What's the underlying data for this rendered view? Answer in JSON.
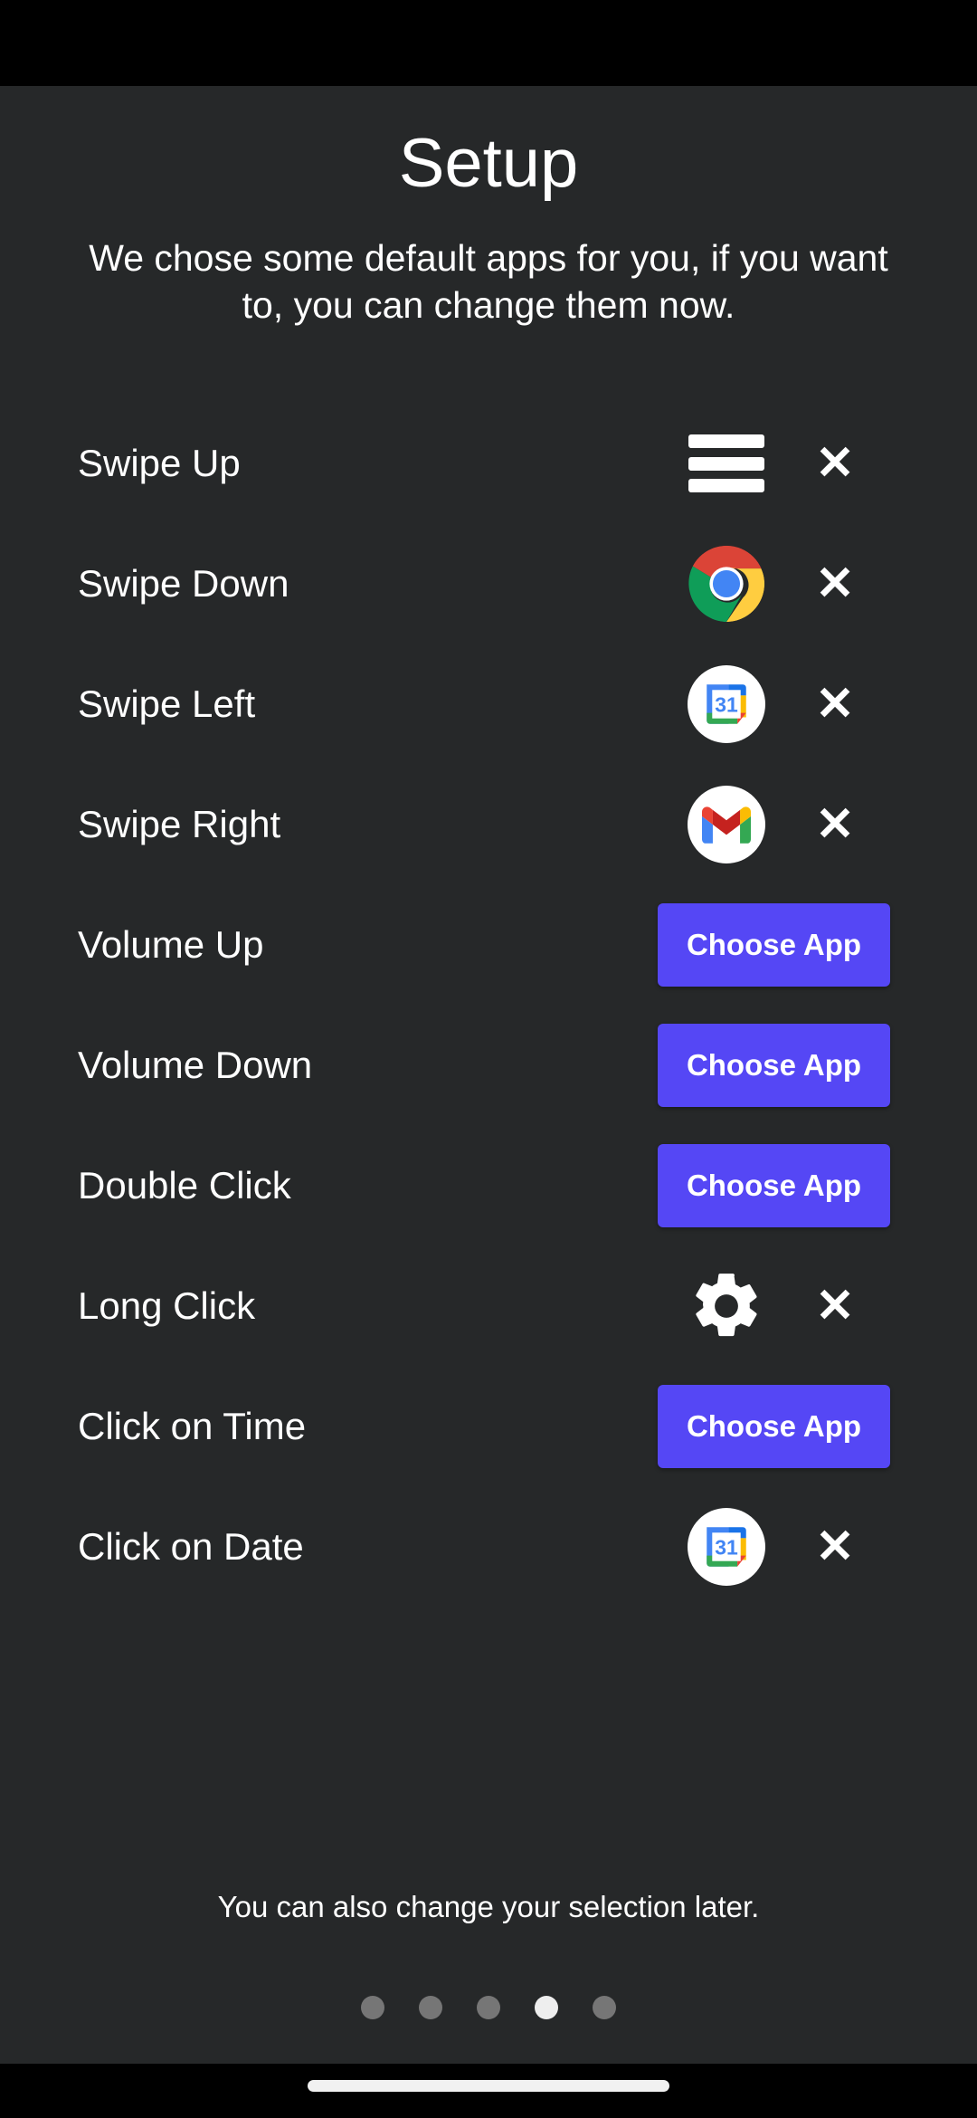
{
  "screen": {
    "background_color": "#262829",
    "status_bar_color": "#000000",
    "nav_bar_color": "#000000"
  },
  "header": {
    "title": "Setup",
    "subtitle": "We chose some default apps for you, if you want to, you can change them now."
  },
  "theme": {
    "accent_button_color": "#5547F5",
    "text_color": "#ffffff",
    "dot_inactive_color": "#767676",
    "dot_active_color": "#eeeeee"
  },
  "gestures": [
    {
      "label": "Swipe Up",
      "action_type": "icon",
      "icon": "hamburger-menu-icon",
      "remove_label": "✕"
    },
    {
      "label": "Swipe Down",
      "action_type": "icon",
      "icon": "chrome-icon",
      "remove_label": "✕"
    },
    {
      "label": "Swipe Left",
      "action_type": "icon",
      "icon": "google-calendar-icon",
      "remove_label": "✕"
    },
    {
      "label": "Swipe Right",
      "action_type": "icon",
      "icon": "gmail-icon",
      "remove_label": "✕"
    },
    {
      "label": "Volume Up",
      "action_type": "button",
      "button_label": "Choose App"
    },
    {
      "label": "Volume Down",
      "action_type": "button",
      "button_label": "Choose App"
    },
    {
      "label": "Double Click",
      "action_type": "button",
      "button_label": "Choose App"
    },
    {
      "label": "Long Click",
      "action_type": "icon",
      "icon": "gear-icon",
      "remove_label": "✕"
    },
    {
      "label": "Click on Time",
      "action_type": "button",
      "button_label": "Choose App"
    },
    {
      "label": "Click on Date",
      "action_type": "icon",
      "icon": "google-calendar-icon",
      "remove_label": "✕"
    }
  ],
  "footer": {
    "note": "You can also change your selection later.",
    "page_dots": {
      "count": 5,
      "active_index": 3
    }
  },
  "calendar_icon": {
    "day_number": "31"
  }
}
